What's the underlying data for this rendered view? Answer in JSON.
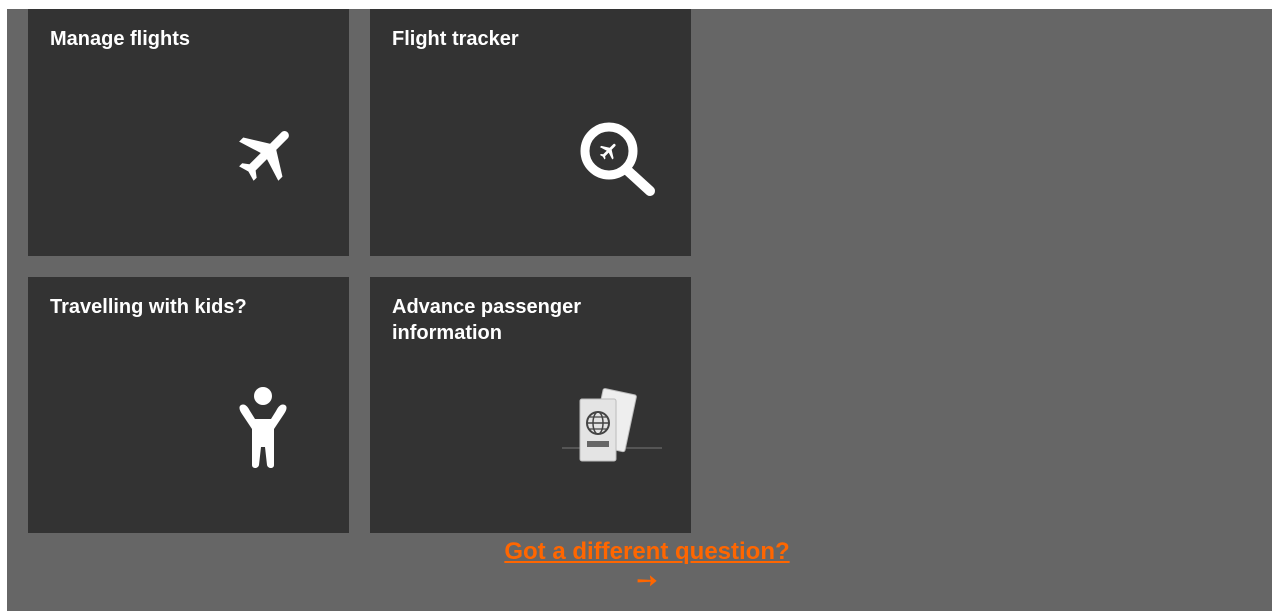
{
  "tiles": [
    {
      "title": "Manage flights",
      "icon": "airplane-icon"
    },
    {
      "title": "Flight tracker",
      "icon": "flight-search-icon"
    },
    {
      "title": "Travelling with kids?",
      "icon": "child-icon"
    },
    {
      "title": "Advance passenger information",
      "icon": "passport-icon"
    }
  ],
  "cta": {
    "label": "Got a different question?",
    "arrow": "➙"
  },
  "colors": {
    "panel": "#666666",
    "tile": "#333333",
    "accent": "#ff6600",
    "text": "#ffffff"
  }
}
